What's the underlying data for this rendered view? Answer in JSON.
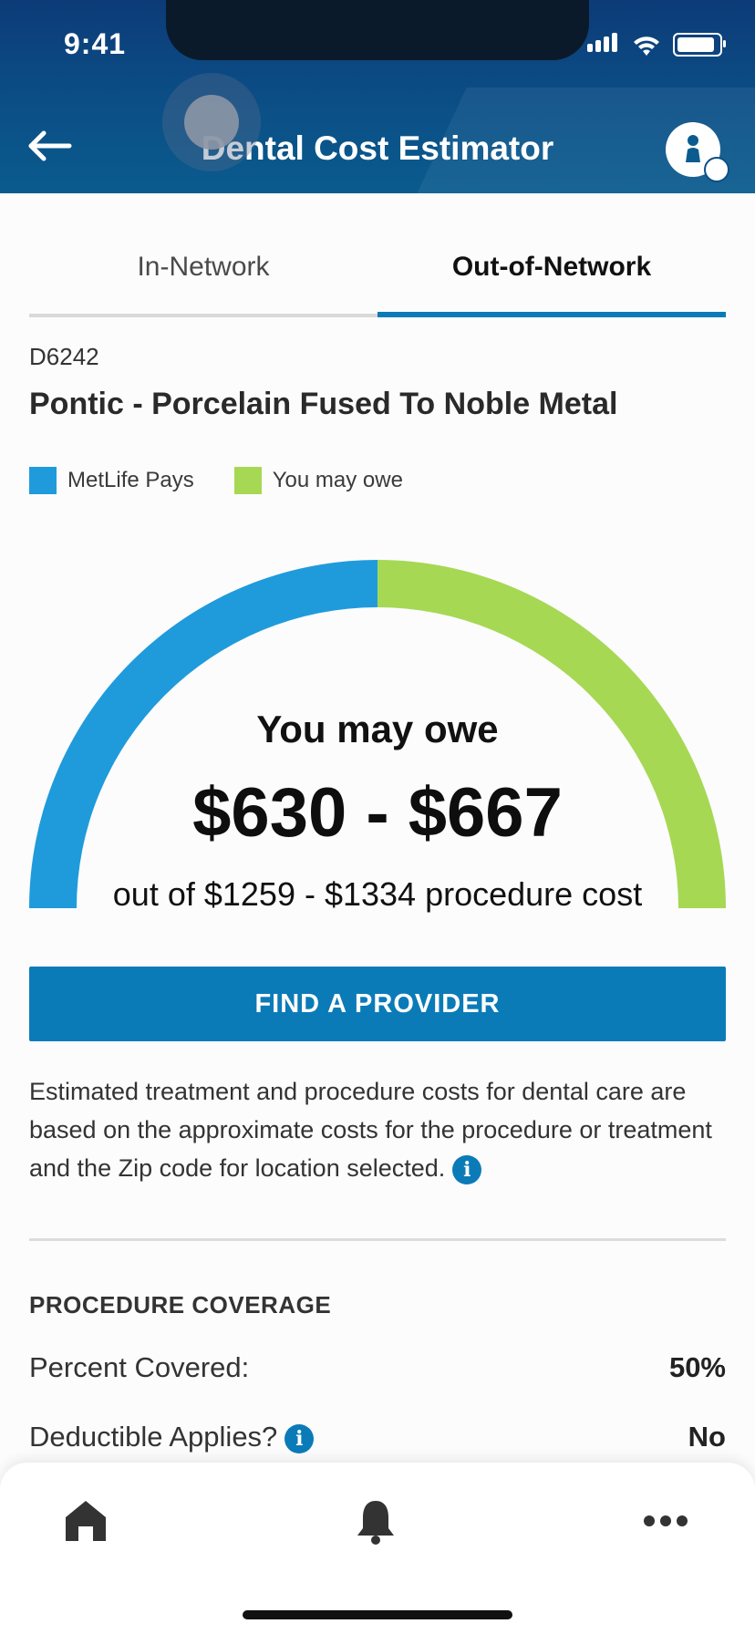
{
  "status_bar": {
    "time": "9:41"
  },
  "header": {
    "title": "Dental Cost Estimator"
  },
  "tabs": [
    {
      "label": "In-Network",
      "active": false
    },
    {
      "label": "Out-of-Network",
      "active": true
    }
  ],
  "procedure": {
    "code": "D6242",
    "name": "Pontic - Porcelain Fused To Noble Metal"
  },
  "legend": [
    {
      "label": "MetLife Pays",
      "color": "#1f9bdc"
    },
    {
      "label": "You may owe",
      "color": "#a6d854"
    }
  ],
  "chart_data": {
    "type": "pie",
    "style": "semicircle-gauge",
    "categories": [
      "MetLife Pays",
      "You may owe"
    ],
    "values": [
      50,
      50
    ],
    "colors": [
      "#1f9bdc",
      "#a6d854"
    ]
  },
  "estimate": {
    "label": "You may owe",
    "amount": "$630 - $667",
    "subtext": "out of $1259 - $1334 procedure cost"
  },
  "find_provider_label": "FIND A PROVIDER",
  "disclaimer": "Estimated treatment and procedure costs for dental care are based on the approximate costs for the procedure or treatment and the Zip code for location selected.",
  "coverage": {
    "title": "PROCEDURE COVERAGE",
    "rows": [
      {
        "label": "Percent Covered:",
        "value": "50%"
      },
      {
        "label": "Deductible Applies?",
        "value": "No"
      }
    ]
  },
  "bottom_nav": [
    {
      "icon": "home-icon"
    },
    {
      "icon": "bell-icon"
    },
    {
      "icon": "more-icon"
    }
  ]
}
